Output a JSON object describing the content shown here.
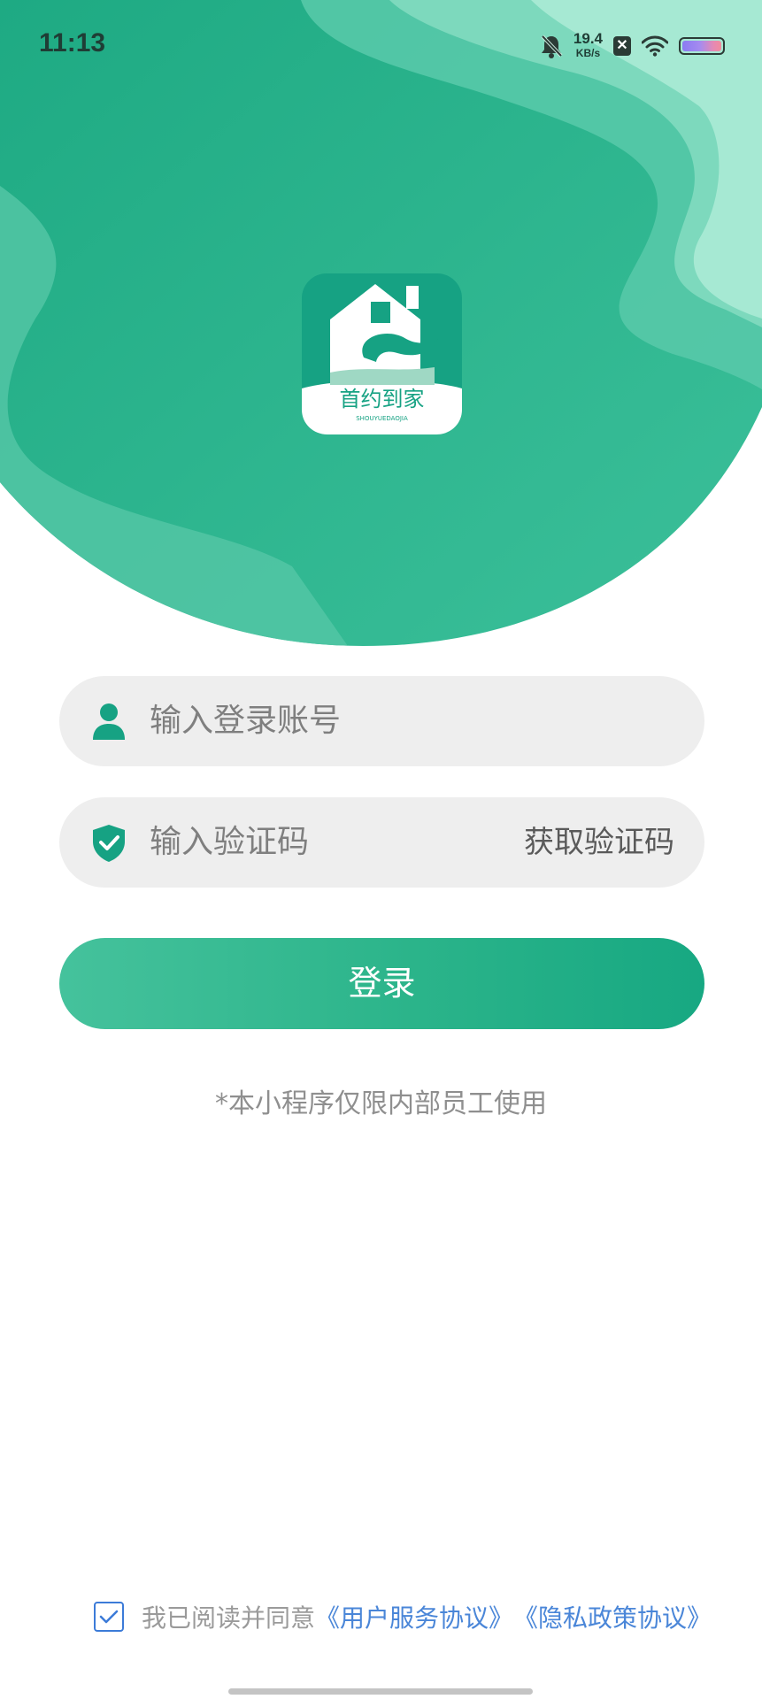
{
  "status_bar": {
    "time": "11:13",
    "net_speed_value": "19.4",
    "net_speed_unit": "KB/s",
    "sim_label": "✕",
    "icons": [
      "mute-bell-icon",
      "sim-x-icon",
      "wifi-icon",
      "battery-icon"
    ]
  },
  "logo": {
    "brand_text": "首约到家",
    "brand_sub": "SHOUYUEDAOJIA"
  },
  "account_field": {
    "placeholder": "输入登录账号",
    "icon": "user-icon"
  },
  "code_field": {
    "placeholder": "输入验证码",
    "get_code_label": "获取验证码",
    "icon": "shield-check-icon"
  },
  "login_button": {
    "label": "登录"
  },
  "note": "*本小程序仅限内部员工使用",
  "agreement": {
    "checked": true,
    "prefix": "我已阅读并同意",
    "user_service": "《用户服务协议》",
    "privacy": "《隐私政策协议》"
  },
  "colors": {
    "brand_green": "#1fae84",
    "link_blue": "#4a86d8",
    "field_bg": "#eeeeee"
  }
}
